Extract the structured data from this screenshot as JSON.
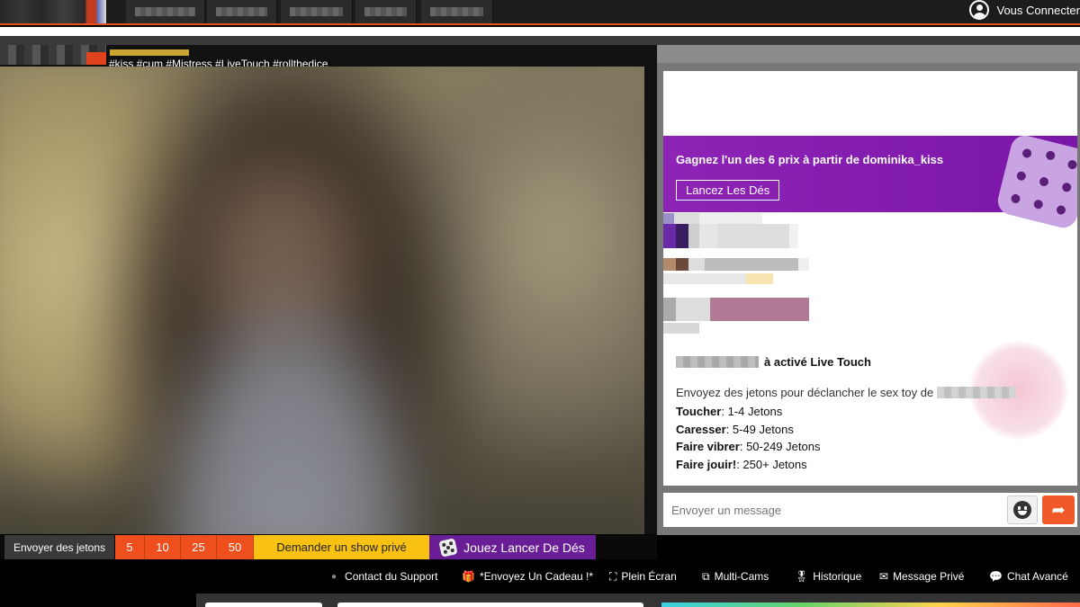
{
  "header": {
    "login_label": "Vous Connecter"
  },
  "stream": {
    "tags": "#kiss #cum #Mistress #LiveTouch #rollthedice"
  },
  "promo": {
    "text": "Gagnez l'un des 6 prix à partir de dominika_kiss",
    "button_label": "Lancez Les Dés"
  },
  "chat": {
    "live_touch_text": "à activé Live Touch",
    "description": "Envoyez des jetons pour déclancher le sex toy de",
    "levels": [
      {
        "name": "Toucher",
        "range": "1-4 Jetons"
      },
      {
        "name": "Caresser",
        "range": "5-49 Jetons"
      },
      {
        "name": "Faire vibrer",
        "range": "50-249 Jetons"
      },
      {
        "name": "Faire jouir!",
        "range": "250+ Jetons"
      }
    ],
    "message_placeholder": "Envoyer un message"
  },
  "tipbar": {
    "label": "Envoyer des jetons",
    "amounts": [
      "5",
      "10",
      "25",
      "50"
    ],
    "private_show_label": "Demander un show privé",
    "dice_label": "Jouez Lancer De Dés"
  },
  "toolbar": {
    "support": "Contact du Support",
    "gift": "*Envoyez Un Cadeau !*",
    "fullscreen": "Plein Écran",
    "multicam": "Multi-Cams",
    "history": "Historique",
    "private_message": "Message Privé",
    "advanced_chat": "Chat Avancé"
  },
  "colors": {
    "accent_orange": "#ef4f1d",
    "promo_purple": "#8e24b6",
    "private_yellow": "#f9c112",
    "dice_purple": "#6a1e95"
  },
  "icons": {
    "user": "user-circle-icon",
    "emoji": "smiley-icon",
    "send": "arrow-send-icon",
    "dice": "dice-icon",
    "gift": "gift-icon",
    "fullscreen": "fullscreen-icon",
    "multicam": "multicam-icon",
    "history": "medal-icon",
    "mail": "envelope-icon",
    "chat": "chat-bubble-icon"
  }
}
